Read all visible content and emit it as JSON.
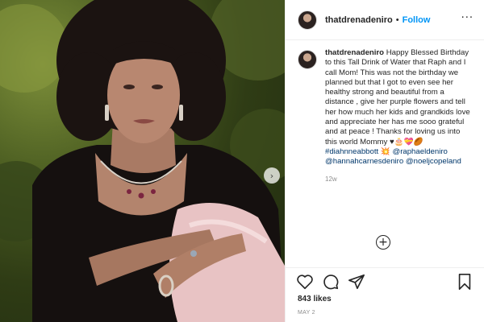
{
  "post": {
    "username": "thatdrenadeniro",
    "follow_label": "Follow",
    "separator": "•",
    "more_icon": "more-horizontal-icon",
    "carousel_next_icon": "chevron-right-icon",
    "caption": {
      "username": "thatdrenadeniro",
      "text": "Happy Blessed Birthday to this Tall Drink of Water that Raph and I call Mom! This was not the birthday we planned but that I got to even see her healthy strong and beautiful from a distance , give her purple flowers and tell her how much her kids and grandkids love and appreciate her has me sooo grateful and at peace ! Thanks for loving us into this world Mommy ♥🎂💝🏉",
      "hashtag": "#diahnneabbott",
      "mention_emoji": "💥",
      "mentions": [
        "@raphaeldeniro",
        "@hannahcarnesdeniro",
        "@noeljcopeland"
      ]
    },
    "timestamp": "12w",
    "load_more_label": "+",
    "likes": "843 likes",
    "date": "MAY 2"
  }
}
